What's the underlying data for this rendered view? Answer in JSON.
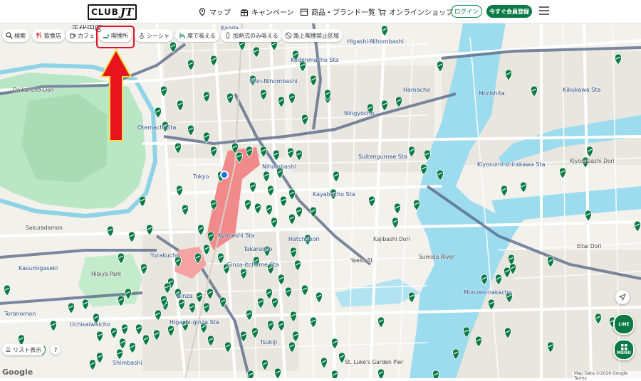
{
  "header": {
    "logo_text": "CLUB",
    "logo_mark": "JT",
    "nav": [
      {
        "label": "マップ",
        "icon": "map-pin-icon"
      },
      {
        "label": "キャンペーン",
        "icon": "gift-icon"
      },
      {
        "label": "商品・ブランド一覧",
        "icon": "catalog-icon"
      },
      {
        "label": "オンラインショップ",
        "icon": "cart-icon"
      }
    ],
    "login_label": "ログイン",
    "join_label": "今すぐ会員登録"
  },
  "filters": [
    {
      "label": "検索",
      "icon": "search-icon"
    },
    {
      "label": "飲食店",
      "icon": "restaurant-icon"
    },
    {
      "label": "カフェ",
      "icon": "cafe-icon"
    },
    {
      "label": "喫煙所",
      "icon": "smoking-area-icon"
    },
    {
      "label": "シーシャ",
      "icon": "shisha-icon"
    },
    {
      "label": "席で吸える",
      "icon": "seat-icon"
    },
    {
      "label": "加熱式のみ吸える",
      "icon": "heated-tobacco-icon"
    },
    {
      "label": "路上喫煙禁止区域",
      "icon": "no-smoking-icon"
    }
  ],
  "map": {
    "district_label": "千代田区",
    "labels": [
      {
        "text": "Daikancho-Dori",
        "cls": ""
      },
      {
        "text": "Otemachi Sta",
        "cls": "station"
      },
      {
        "text": "Tokyo",
        "cls": "station"
      },
      {
        "text": "Nihombashi",
        "cls": "station"
      },
      {
        "text": "Shin-Nihombashi",
        "cls": "station"
      },
      {
        "text": "Kodenmacho Sta",
        "cls": "station"
      },
      {
        "text": "Higashi-Nihombashi",
        "cls": "station"
      },
      {
        "text": "Ningyocho",
        "cls": "station"
      },
      {
        "text": "Suitengumae Sta",
        "cls": "station"
      },
      {
        "text": "Kayabacho Sta",
        "cls": "station"
      },
      {
        "text": "Kyobashi Sta",
        "cls": "station"
      },
      {
        "text": "Takaracho",
        "cls": "station"
      },
      {
        "text": "Hatchobori",
        "cls": "station"
      },
      {
        "text": "Kajibashi Dori",
        "cls": ""
      },
      {
        "text": "Yurakucho",
        "cls": "station"
      },
      {
        "text": "Ginza-itchome Sta",
        "cls": "station"
      },
      {
        "text": "Ginza",
        "cls": "station"
      },
      {
        "text": "Higashi-ginza Sta",
        "cls": "station"
      },
      {
        "text": "Tsukiji",
        "cls": "station"
      },
      {
        "text": "Monzen-nakacho",
        "cls": "station"
      },
      {
        "text": "Kiyosumi-shirakawa Sta",
        "cls": "station"
      },
      {
        "text": "Morishita",
        "cls": "station"
      },
      {
        "text": "Kikukawa Sta",
        "cls": "station"
      },
      {
        "text": "Hamacho",
        "cls": "station"
      },
      {
        "text": "Kasumigaseki",
        "cls": "station"
      },
      {
        "text": "Toranomon",
        "cls": "station"
      },
      {
        "text": "Sakuradamon",
        "cls": ""
      },
      {
        "text": "Hibiya Park",
        "cls": ""
      },
      {
        "text": "Uchisaiwaicho",
        "cls": "station"
      },
      {
        "text": "St. Luke's Garden Pier",
        "cls": ""
      },
      {
        "text": "Sumida River",
        "cls": ""
      },
      {
        "text": "Yaesu St",
        "cls": ""
      },
      {
        "text": "Kiyosubashi Dori",
        "cls": ""
      },
      {
        "text": "Shimbashi",
        "cls": "station"
      },
      {
        "text": "Eitai Dori",
        "cls": ""
      },
      {
        "text": "Kanda",
        "cls": "station"
      }
    ]
  },
  "controls": {
    "list_label": "リスト表示",
    "help_label": "?",
    "line_label": "LINE",
    "menu_label": "MENU",
    "attribution": "Map Data ©2026 Google    Terms",
    "google_label": "Google"
  },
  "colors": {
    "brand_green": "#0b7a45",
    "highlight_red": "#e0122a",
    "water": "#9ddcee",
    "park": "#b9e6c4",
    "road": "#ffffff",
    "highway": "#5a6b8a"
  }
}
